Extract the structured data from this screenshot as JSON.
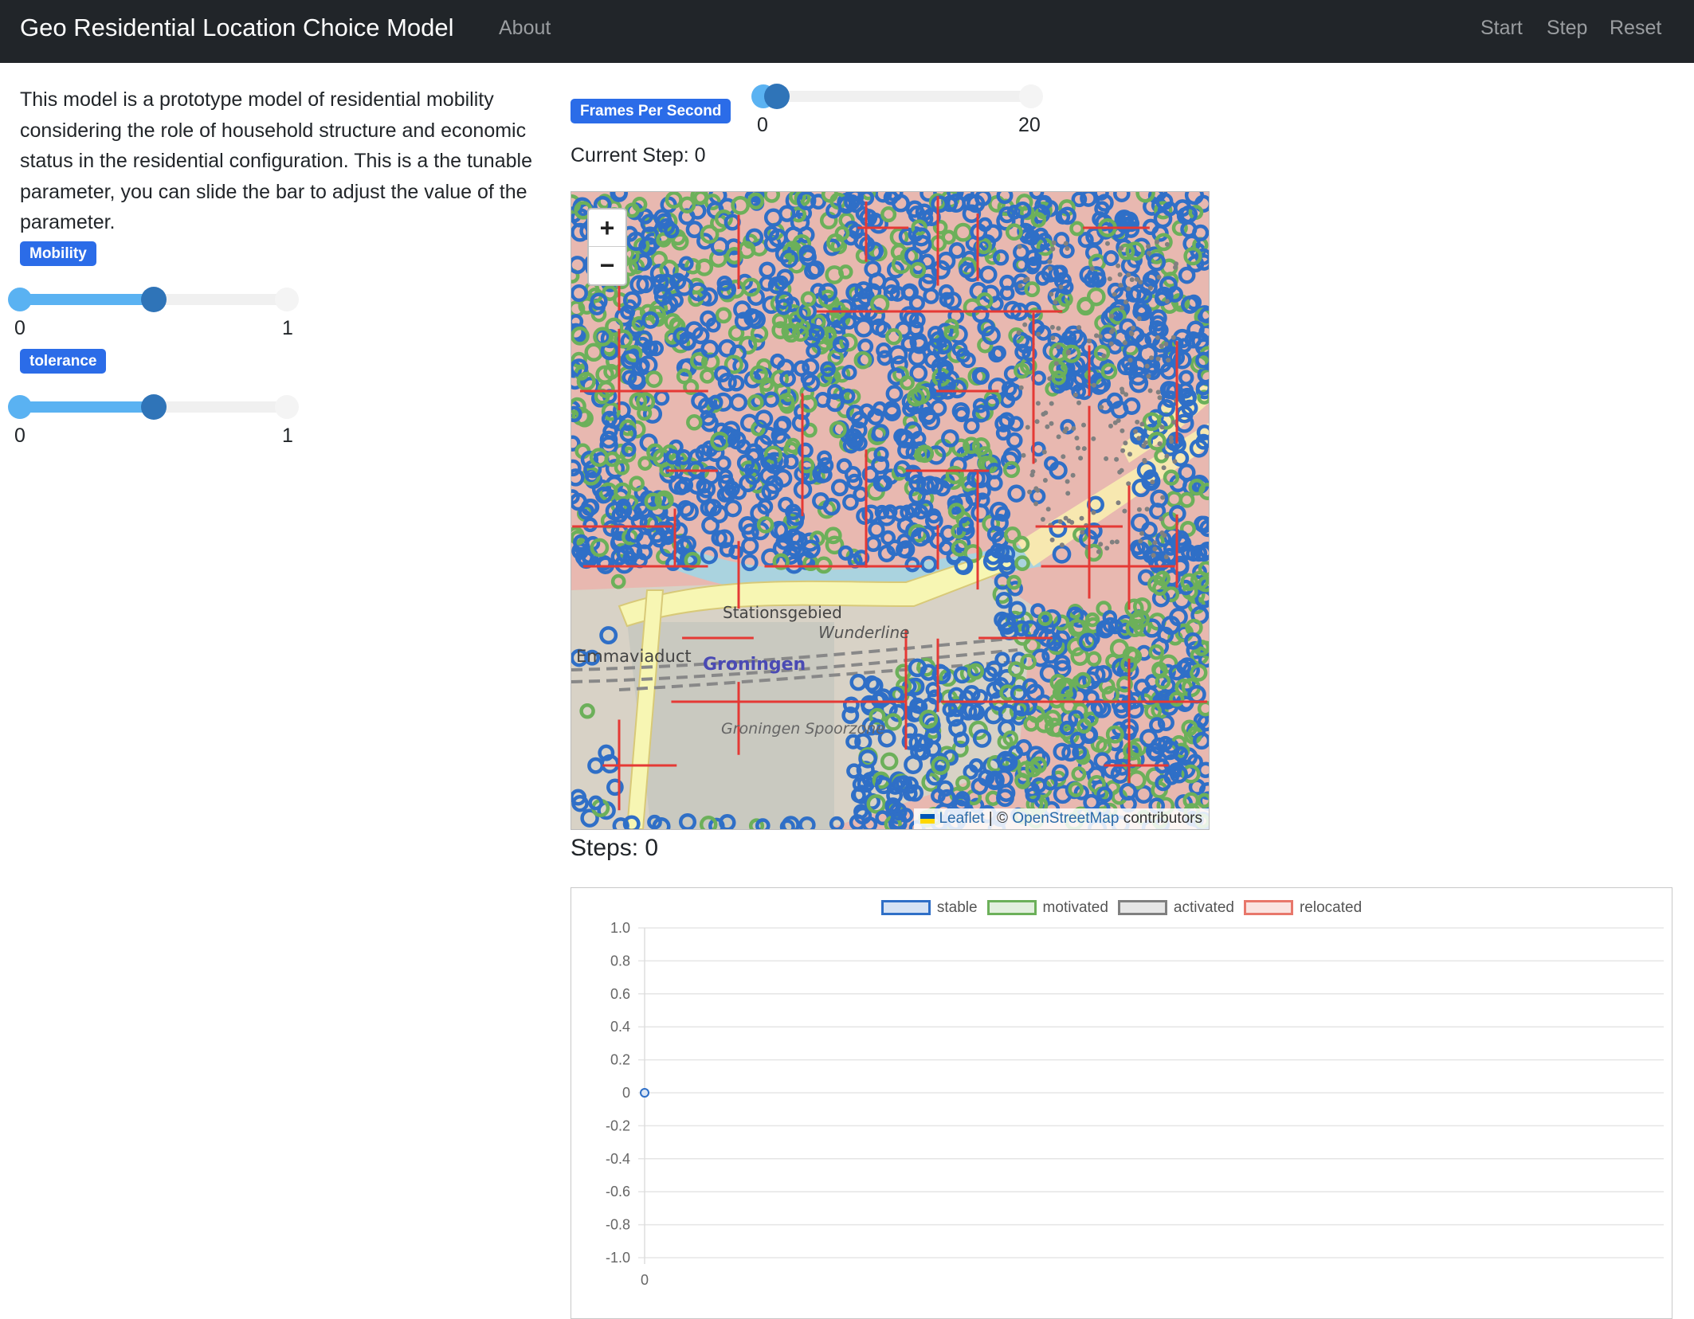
{
  "navbar": {
    "title": "Geo Residential Location Choice Model",
    "about": "About",
    "start": "Start",
    "step": "Step",
    "reset": "Reset"
  },
  "sidebar": {
    "description": "This model is a prototype model of residential mobility considering the role of household structure and economic status in the residential configuration. This is a the tunable parameter, you can slide the bar to adjust the value of the parameter.",
    "params": [
      {
        "label": "Mobility",
        "min": "0",
        "max": "1",
        "value": 0.5
      },
      {
        "label": "tolerance",
        "min": "0",
        "max": "1",
        "value": 0.5
      }
    ]
  },
  "controls": {
    "fps_label": "Frames Per Second",
    "fps_min": "0",
    "fps_max": "20",
    "fps_value": 1,
    "current_step": "Current Step: 0"
  },
  "map": {
    "zoom_in": "+",
    "zoom_out": "−",
    "labels": {
      "stationsgebied": "Stationsgebied",
      "emmaviaduct": "Emmaviaduct",
      "groningen": "Groningen",
      "wunderline": "Wunderline",
      "spoorzone": "Groningen Spoorzone"
    },
    "attribution_leaflet": "Leaflet",
    "attribution_sep": "| ©",
    "attribution_osm": "OpenStreetMap",
    "attribution_tail": "contributors",
    "colors": {
      "stable": "#2f6fc7",
      "motivated": "#6cb05a",
      "activated": "#808080",
      "grid": "#e53935"
    }
  },
  "steps_label": "Steps: 0",
  "chart_data": {
    "type": "line",
    "series": [
      {
        "name": "stable",
        "color": "#2f6fc7",
        "values": [
          0
        ]
      },
      {
        "name": "motivated",
        "color": "#6cb05a",
        "values": []
      },
      {
        "name": "activated",
        "color": "#808080",
        "values": []
      },
      {
        "name": "relocated",
        "color": "#e8776b",
        "values": []
      }
    ],
    "x": [
      0
    ],
    "x_tick_labels": [
      "0"
    ],
    "y_tick_labels": [
      "1.0",
      "0.8",
      "0.6",
      "0.4",
      "0.2",
      "0",
      "-0.2",
      "-0.4",
      "-0.6",
      "-0.8",
      "-1.0"
    ],
    "ylim": [
      -1.0,
      1.0
    ],
    "legend_position": "top",
    "grid": true
  }
}
